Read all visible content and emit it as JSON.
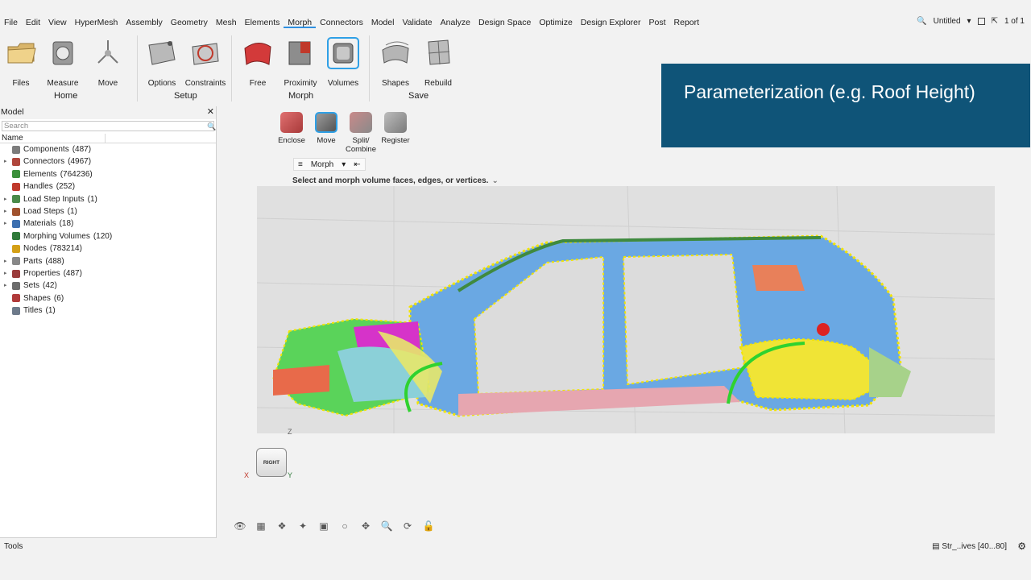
{
  "menu": {
    "items": [
      "File",
      "Edit",
      "View",
      "HyperMesh",
      "Assembly",
      "Geometry",
      "Mesh",
      "Elements",
      "Morph",
      "Connectors",
      "Model",
      "Validate",
      "Analyze",
      "Design Space",
      "Optimize",
      "Design Explorer",
      "Post",
      "Report"
    ],
    "active": "Morph",
    "session_name": "Untitled",
    "page_counter": "1 of 1"
  },
  "ribbon": {
    "groups": [
      "Home",
      "Setup",
      "Morph",
      "Save"
    ],
    "tools": [
      "Files",
      "Measure",
      "Move",
      "Options",
      "Constraints",
      "Free",
      "Proximity",
      "Volumes",
      "Shapes",
      "Rebuild"
    ]
  },
  "overlay": {
    "title": "Parameterization (e.g. Roof Height)",
    "bg_color": "#0f5478"
  },
  "browser": {
    "title": "Model",
    "search_placeholder": "Search",
    "column": "Name",
    "items": [
      {
        "label": "Components",
        "count": "(487)",
        "icon": "components-icon",
        "color": "#7c7c7c",
        "expandable": false
      },
      {
        "label": "Connectors",
        "count": "(4967)",
        "icon": "connectors-icon",
        "color": "#b0463c",
        "expandable": true
      },
      {
        "label": "Elements",
        "count": "(764236)",
        "icon": "elements-icon",
        "color": "#3a8f3a",
        "expandable": false
      },
      {
        "label": "Handles",
        "count": "(252)",
        "icon": "handles-icon",
        "color": "#c0392b",
        "expandable": false
      },
      {
        "label": "Load Step Inputs",
        "count": "(1)",
        "icon": "load-step-inputs-icon",
        "color": "#4a8b4a",
        "expandable": true
      },
      {
        "label": "Load Steps",
        "count": "(1)",
        "icon": "load-steps-icon",
        "color": "#a0522d",
        "expandable": true
      },
      {
        "label": "Materials",
        "count": "(18)",
        "icon": "materials-icon",
        "color": "#3c6fb0",
        "expandable": true
      },
      {
        "label": "Morphing Volumes",
        "count": "(120)",
        "icon": "morphing-volumes-icon",
        "color": "#2f7a3a",
        "expandable": false
      },
      {
        "label": "Nodes",
        "count": "(783214)",
        "icon": "nodes-icon",
        "color": "#d4a017",
        "expandable": false
      },
      {
        "label": "Parts",
        "count": "(488)",
        "icon": "parts-icon",
        "color": "#888888",
        "expandable": true
      },
      {
        "label": "Properties",
        "count": "(487)",
        "icon": "properties-icon",
        "color": "#9a3b3b",
        "expandable": true
      },
      {
        "label": "Sets",
        "count": "(42)",
        "icon": "sets-icon",
        "color": "#6c6c6c",
        "expandable": true
      },
      {
        "label": "Shapes",
        "count": "(6)",
        "icon": "shapes-icon",
        "color": "#b03a3a",
        "expandable": false
      },
      {
        "label": "Titles",
        "count": "(1)",
        "icon": "titles-icon",
        "color": "#6d7a8a",
        "expandable": false
      }
    ]
  },
  "subtools": [
    "Enclose",
    "Move",
    "Split/\nCombine",
    "Register"
  ],
  "minibar": {
    "mode": "Morph"
  },
  "hint": "Select and morph volume faces, edges, or vertices.",
  "viewcube": {
    "face": "RIGHT",
    "axis_x": "X",
    "axis_y": "Y",
    "axis_z": "Z"
  },
  "status": {
    "left": "Tools",
    "right": "Str_..ives [40...80]"
  }
}
